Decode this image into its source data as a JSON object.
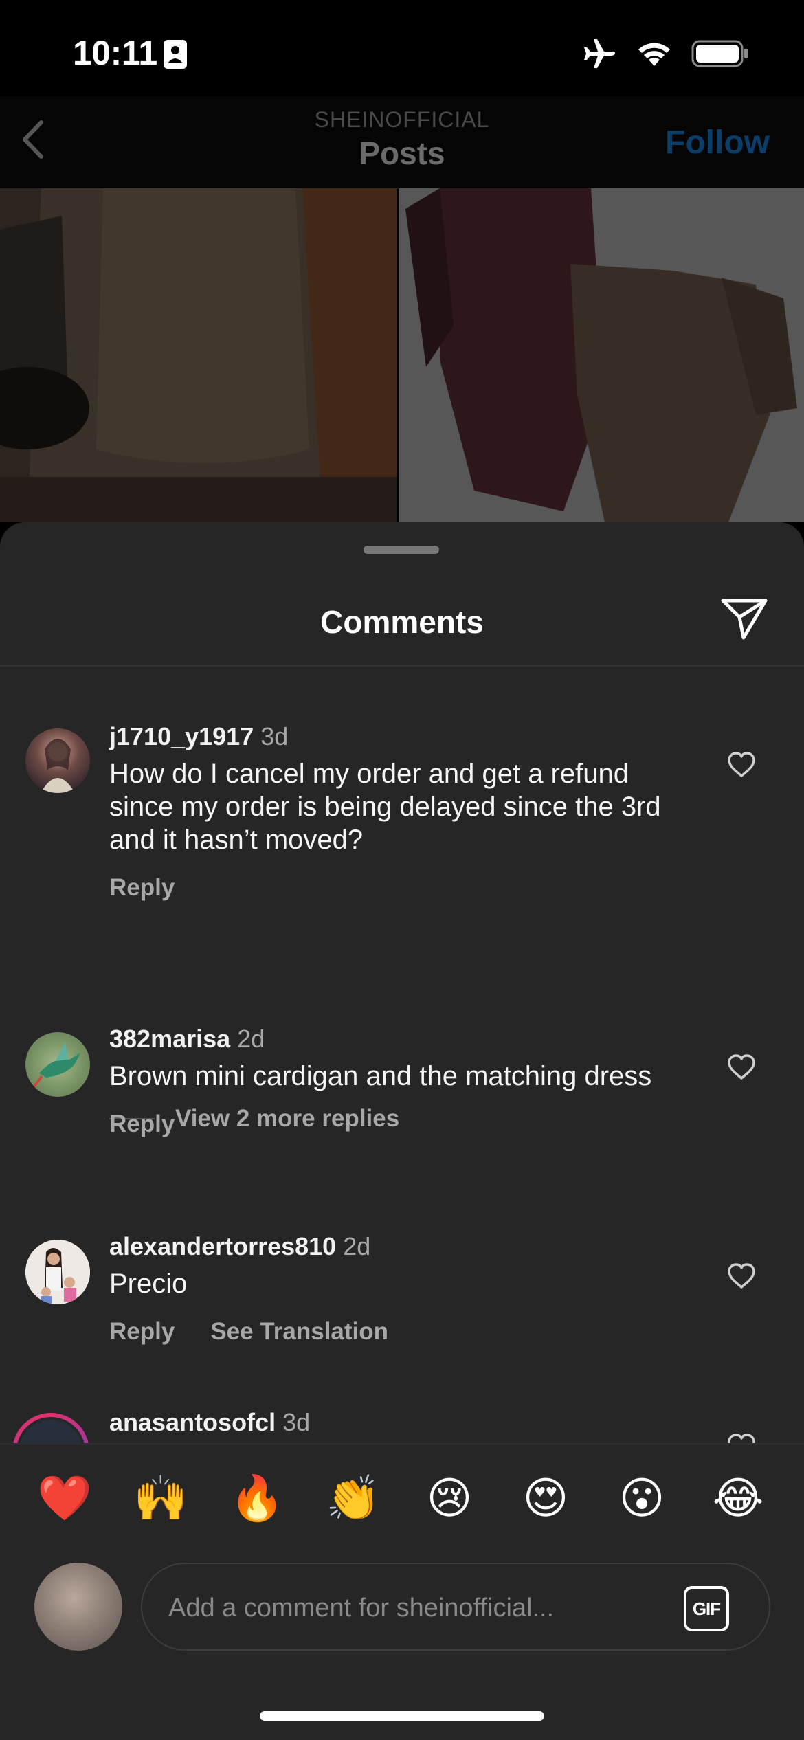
{
  "status_bar": {
    "time": "10:11",
    "icons": [
      "id-card-icon",
      "airplane-icon",
      "wifi-icon",
      "battery-icon"
    ]
  },
  "header": {
    "subtitle": "SHEINOFFICIAL",
    "title": "Posts",
    "follow_label": "Follow",
    "back_icon": "chevron-left-icon"
  },
  "sheet": {
    "title": "Comments",
    "share_icon": "paper-plane-icon"
  },
  "comments": [
    {
      "username": "j1710_y1917",
      "time": "3d",
      "text": "How do I cancel my order and get a refund since my order is being delayed since the 3rd and it hasn’t moved?",
      "reply_label": "Reply"
    },
    {
      "username": "382marisa",
      "time": "2d",
      "text": "Brown mini cardigan and the matching dress",
      "reply_label": "Reply"
    },
    {
      "username": "alexandertorres810",
      "time": "2d",
      "text": "Precio",
      "reply_label": "Reply",
      "translate_label": "See Translation"
    },
    {
      "username": "anasantosofcl",
      "time": "3d"
    }
  ],
  "more_replies_label": "View 2 more replies",
  "emojis": [
    "❤️",
    "🙌",
    "🔥",
    "👏",
    "😢",
    "😍",
    "😮",
    "😂"
  ],
  "comment_input": {
    "placeholder": "Add a comment for sheinofficial...",
    "gif_label": "GIF"
  },
  "colors": {
    "sheet_bg": "#262626",
    "follow_blue": "#0a3d68",
    "secondary_text": "#a8a8a8"
  }
}
